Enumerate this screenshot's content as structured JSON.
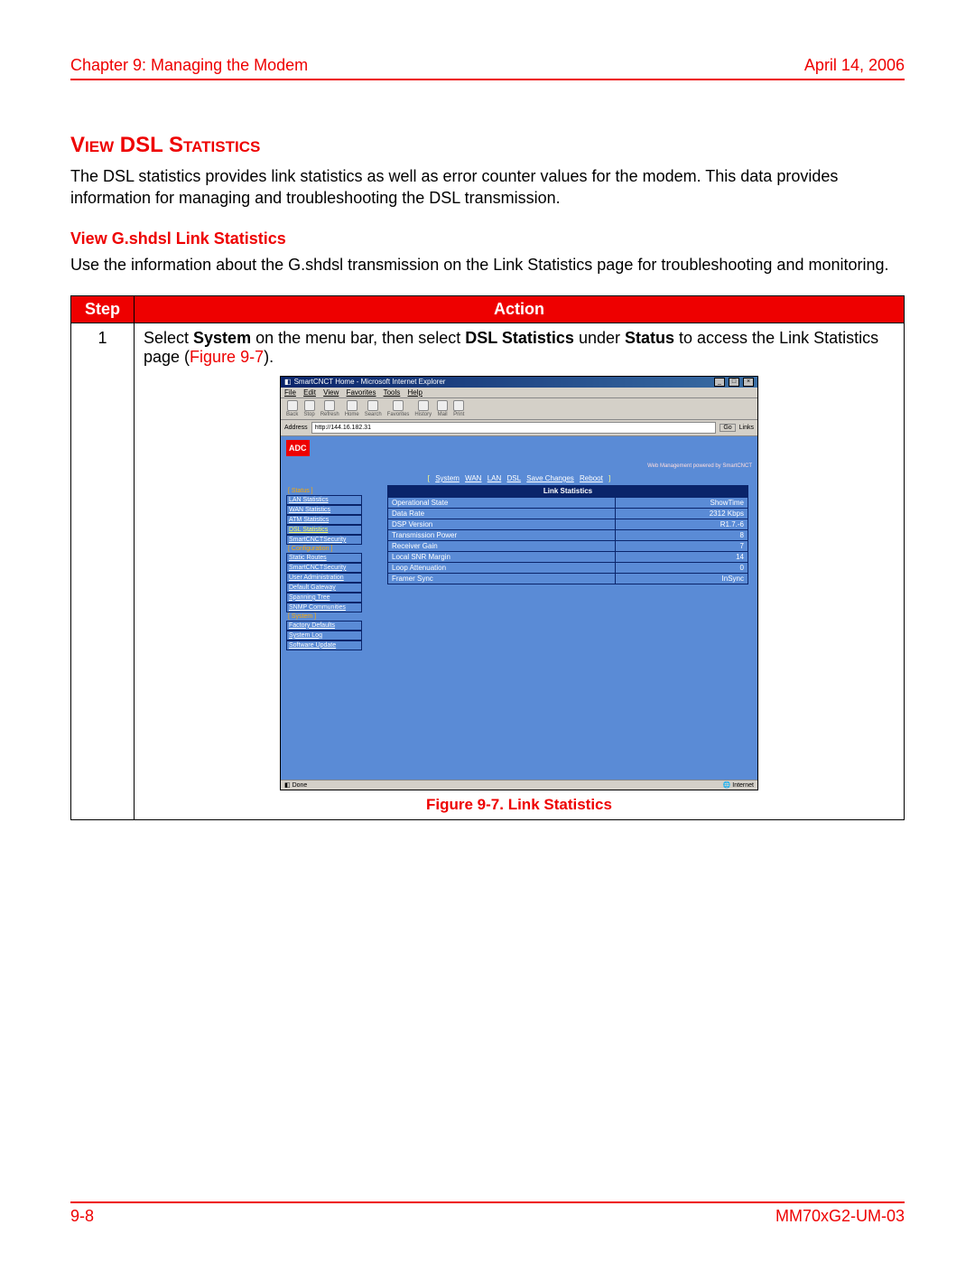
{
  "header": {
    "chapter": "Chapter 9: Managing the Modem",
    "date": "April 14, 2006"
  },
  "section_title": "View DSL Statistics",
  "intro": "The DSL statistics provides link statistics as well as error counter values for the modem. This data provides information for managing and troubleshooting the DSL transmission.",
  "sub_title": "View G.shdsl Link Statistics",
  "sub_text": "Use the information about the G.shdsl transmission on the Link Statistics page for troubleshooting and monitoring.",
  "table_headers": {
    "step": "Step",
    "action": "Action"
  },
  "step_num": "1",
  "action": {
    "pre1": "Select ",
    "b1": "System",
    "mid1": " on the menu bar, then select ",
    "b2": "DSL Statistics",
    "mid2": " under ",
    "b3": "Status",
    "mid3": " to access the Link Statistics page (",
    "figref": "Figure 9-7",
    "post": ")."
  },
  "ie": {
    "title": "SmartCNCT Home - Microsoft Internet Explorer",
    "menu": {
      "file": "File",
      "edit": "Edit",
      "view": "View",
      "fav": "Favorites",
      "tools": "Tools",
      "help": "Help"
    },
    "toolbar": {
      "back": "Back",
      "stop": "Stop",
      "refresh": "Refresh",
      "home": "Home",
      "search": "Search",
      "favorites": "Favorites",
      "history": "History",
      "mail": "Mail",
      "print": "Print"
    },
    "addr_label": "Address",
    "addr_value": "http://144.16.182.31",
    "go": "Go",
    "links": "Links",
    "status_left": "Done",
    "status_right": "Internet"
  },
  "brand": "ADC",
  "web_note": "Web Management powered by SmartCNCT",
  "toplinks": {
    "system": "System",
    "wan": "WAN",
    "lan": "LAN",
    "dsl": "DSL",
    "save": "Save Changes",
    "reboot": "Reboot"
  },
  "sidenav": {
    "grp_status": "[ Status ]",
    "lan_stat": "LAN Statistics",
    "wan_stat": "WAN Statistics",
    "atm_stat": "ATM Statistics",
    "dsl_stat": "DSL Statistics",
    "sec1": "SmartCNCTSecurity",
    "grp_conf": "[ Configuration ]",
    "static_routes": "Static Routes",
    "sec2": "SmartCNCTSecurity",
    "user_admin": "User Administration",
    "def_gw": "Default Gateway",
    "spanning": "Spanning Tree",
    "snmp": "SNMP Communities",
    "grp_sys": "[ System ]",
    "factory": "Factory Defaults",
    "syslog": "System Log",
    "swupdate": "Software Update"
  },
  "stats": {
    "title": "Link Statistics",
    "rows": [
      {
        "k": "Operational State",
        "v": "ShowTime"
      },
      {
        "k": "Data Rate",
        "v": "2312 Kbps"
      },
      {
        "k": "DSP Version",
        "v": "R1.7.-6"
      },
      {
        "k": "Transmission Power",
        "v": "8"
      },
      {
        "k": "Receiver Gain",
        "v": "7"
      },
      {
        "k": "Local SNR Margin",
        "v": "14"
      },
      {
        "k": "Loop Attenuation",
        "v": "0"
      },
      {
        "k": "Framer Sync",
        "v": "InSync"
      }
    ]
  },
  "fig_caption": "Figure 9-7. Link Statistics",
  "footer": {
    "page": "9-8",
    "doc": "MM70xG2-UM-03"
  }
}
